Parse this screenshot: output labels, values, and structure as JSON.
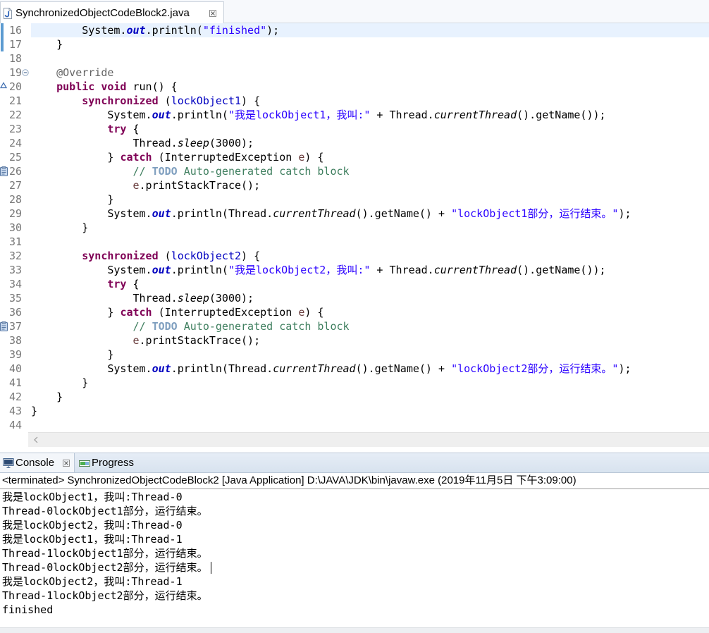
{
  "editor": {
    "tab": {
      "title": "SynchronizedObjectCodeBlock2.java",
      "icon": "java-file-icon",
      "close_icon": "close-icon"
    },
    "lines": [
      {
        "number": "16",
        "quick_diff": true,
        "current": true,
        "tokens": [
          {
            "plain": "        System."
          },
          {
            "static_field": "out"
          },
          {
            "plain": ".println("
          },
          {
            "string": "\"finished\""
          },
          {
            "plain": ");"
          }
        ]
      },
      {
        "number": "17",
        "quick_diff": true,
        "tokens": [
          {
            "plain": "    }"
          }
        ]
      },
      {
        "number": "18",
        "tokens": []
      },
      {
        "number": "19",
        "fold_icon": "fold-collapse-icon",
        "tokens": [
          {
            "plain": "    "
          },
          {
            "annotation": "@Override"
          }
        ]
      },
      {
        "number": "20",
        "marker_icon": "override-marker-icon",
        "tokens": [
          {
            "plain": "    "
          },
          {
            "keyword": "public"
          },
          {
            "plain": " "
          },
          {
            "keyword": "void"
          },
          {
            "plain": " run() {"
          }
        ]
      },
      {
        "number": "21",
        "tokens": [
          {
            "plain": "        "
          },
          {
            "keyword": "synchronized"
          },
          {
            "plain": " ("
          },
          {
            "field": "lockObject1"
          },
          {
            "plain": ") {"
          }
        ]
      },
      {
        "number": "22",
        "tokens": [
          {
            "plain": "            System."
          },
          {
            "static_field": "out"
          },
          {
            "plain": ".println("
          },
          {
            "string": "\"我是lockObject1，我叫:\""
          },
          {
            "plain": " + Thread."
          },
          {
            "static_method": "currentThread"
          },
          {
            "plain": "().getName());"
          }
        ]
      },
      {
        "number": "23",
        "tokens": [
          {
            "plain": "            "
          },
          {
            "keyword": "try"
          },
          {
            "plain": " {"
          }
        ]
      },
      {
        "number": "24",
        "tokens": [
          {
            "plain": "                Thread."
          },
          {
            "static_method": "sleep"
          },
          {
            "plain": "(3000);"
          }
        ]
      },
      {
        "number": "25",
        "tokens": [
          {
            "plain": "            } "
          },
          {
            "keyword": "catch"
          },
          {
            "plain": " (InterruptedException "
          },
          {
            "local_variable": "e"
          },
          {
            "plain": ") {"
          }
        ]
      },
      {
        "number": "26",
        "marker_icon": "task-icon",
        "tokens": [
          {
            "plain": "                "
          },
          {
            "comment": "// "
          },
          {
            "todo_tag": "TODO"
          },
          {
            "comment": " Auto-generated catch block"
          }
        ]
      },
      {
        "number": "27",
        "tokens": [
          {
            "plain": "                "
          },
          {
            "local_variable": "e"
          },
          {
            "plain": ".printStackTrace();"
          }
        ]
      },
      {
        "number": "28",
        "tokens": [
          {
            "plain": "            }"
          }
        ]
      },
      {
        "number": "29",
        "tokens": [
          {
            "plain": "            System."
          },
          {
            "static_field": "out"
          },
          {
            "plain": ".println(Thread."
          },
          {
            "static_method": "currentThread"
          },
          {
            "plain": "().getName() + "
          },
          {
            "string": "\"lockObject1部分，运行结束。\""
          },
          {
            "plain": ");"
          }
        ]
      },
      {
        "number": "30",
        "tokens": [
          {
            "plain": "        }"
          }
        ]
      },
      {
        "number": "31",
        "tokens": []
      },
      {
        "number": "32",
        "tokens": [
          {
            "plain": "        "
          },
          {
            "keyword": "synchronized"
          },
          {
            "plain": " ("
          },
          {
            "field": "lockObject2"
          },
          {
            "plain": ") {"
          }
        ]
      },
      {
        "number": "33",
        "tokens": [
          {
            "plain": "            System."
          },
          {
            "static_field": "out"
          },
          {
            "plain": ".println("
          },
          {
            "string": "\"我是lockObject2，我叫:\""
          },
          {
            "plain": " + Thread."
          },
          {
            "static_method": "currentThread"
          },
          {
            "plain": "().getName());"
          }
        ]
      },
      {
        "number": "34",
        "tokens": [
          {
            "plain": "            "
          },
          {
            "keyword": "try"
          },
          {
            "plain": " {"
          }
        ]
      },
      {
        "number": "35",
        "tokens": [
          {
            "plain": "                Thread."
          },
          {
            "static_method": "sleep"
          },
          {
            "plain": "(3000);"
          }
        ]
      },
      {
        "number": "36",
        "tokens": [
          {
            "plain": "            } "
          },
          {
            "keyword": "catch"
          },
          {
            "plain": " (InterruptedException "
          },
          {
            "local_variable": "e"
          },
          {
            "plain": ") {"
          }
        ]
      },
      {
        "number": "37",
        "marker_icon": "task-icon",
        "tokens": [
          {
            "plain": "                "
          },
          {
            "comment": "// "
          },
          {
            "todo_tag": "TODO"
          },
          {
            "comment": " Auto-generated catch block"
          }
        ]
      },
      {
        "number": "38",
        "tokens": [
          {
            "plain": "                "
          },
          {
            "local_variable": "e"
          },
          {
            "plain": ".printStackTrace();"
          }
        ]
      },
      {
        "number": "39",
        "tokens": [
          {
            "plain": "            }"
          }
        ]
      },
      {
        "number": "40",
        "tokens": [
          {
            "plain": "            System."
          },
          {
            "static_field": "out"
          },
          {
            "plain": ".println(Thread."
          },
          {
            "static_method": "currentThread"
          },
          {
            "plain": "().getName() + "
          },
          {
            "string": "\"lockObject2部分，运行结束。\""
          },
          {
            "plain": ");"
          }
        ]
      },
      {
        "number": "41",
        "tokens": [
          {
            "plain": "        }"
          }
        ]
      },
      {
        "number": "42",
        "tokens": [
          {
            "plain": "    }"
          }
        ]
      },
      {
        "number": "43",
        "tokens": [
          {
            "plain": "}"
          }
        ]
      },
      {
        "number": "44",
        "tokens": []
      }
    ],
    "hscroll": {
      "left_arrow_icon": "chevron-left-icon"
    }
  },
  "console": {
    "tabs": [
      {
        "label": "Console",
        "icon": "console-icon",
        "close_icon": "close-icon",
        "active": true
      },
      {
        "label": "Progress",
        "icon": "progress-icon",
        "active": false
      }
    ],
    "header": "<terminated> SynchronizedObjectCodeBlock2 [Java Application] D:\\JAVA\\JDK\\bin\\javaw.exe (2019年11月5日 下午3:09:00)",
    "output": [
      {
        "text": "我是lockObject1，我叫:Thread-0"
      },
      {
        "text": "Thread-0lockObject1部分，运行结束。"
      },
      {
        "text": "我是lockObject2，我叫:Thread-0"
      },
      {
        "text": "我是lockObject1，我叫:Thread-1"
      },
      {
        "text": "Thread-1lockObject1部分，运行结束。"
      },
      {
        "text": "Thread-0lockObject2部分，运行结束。",
        "caret": true
      },
      {
        "text": "我是lockObject2，我叫:Thread-1"
      },
      {
        "text": "Thread-1lockObject2部分，运行结束。"
      },
      {
        "text": "finished"
      }
    ]
  },
  "colors": {
    "keyword": "#7F0055",
    "string": "#2A00FF",
    "field": "#0000C0",
    "static_field": "#0000C0",
    "comment": "#3F7F5F",
    "todo_tag": "#7F9FBF",
    "annotation": "#646464",
    "local_variable": "#6A3E3E",
    "line_number": "#787878",
    "current_line": "#E8F2FE",
    "quick_diff": "#5C9BD1",
    "console_text": "#000000"
  }
}
